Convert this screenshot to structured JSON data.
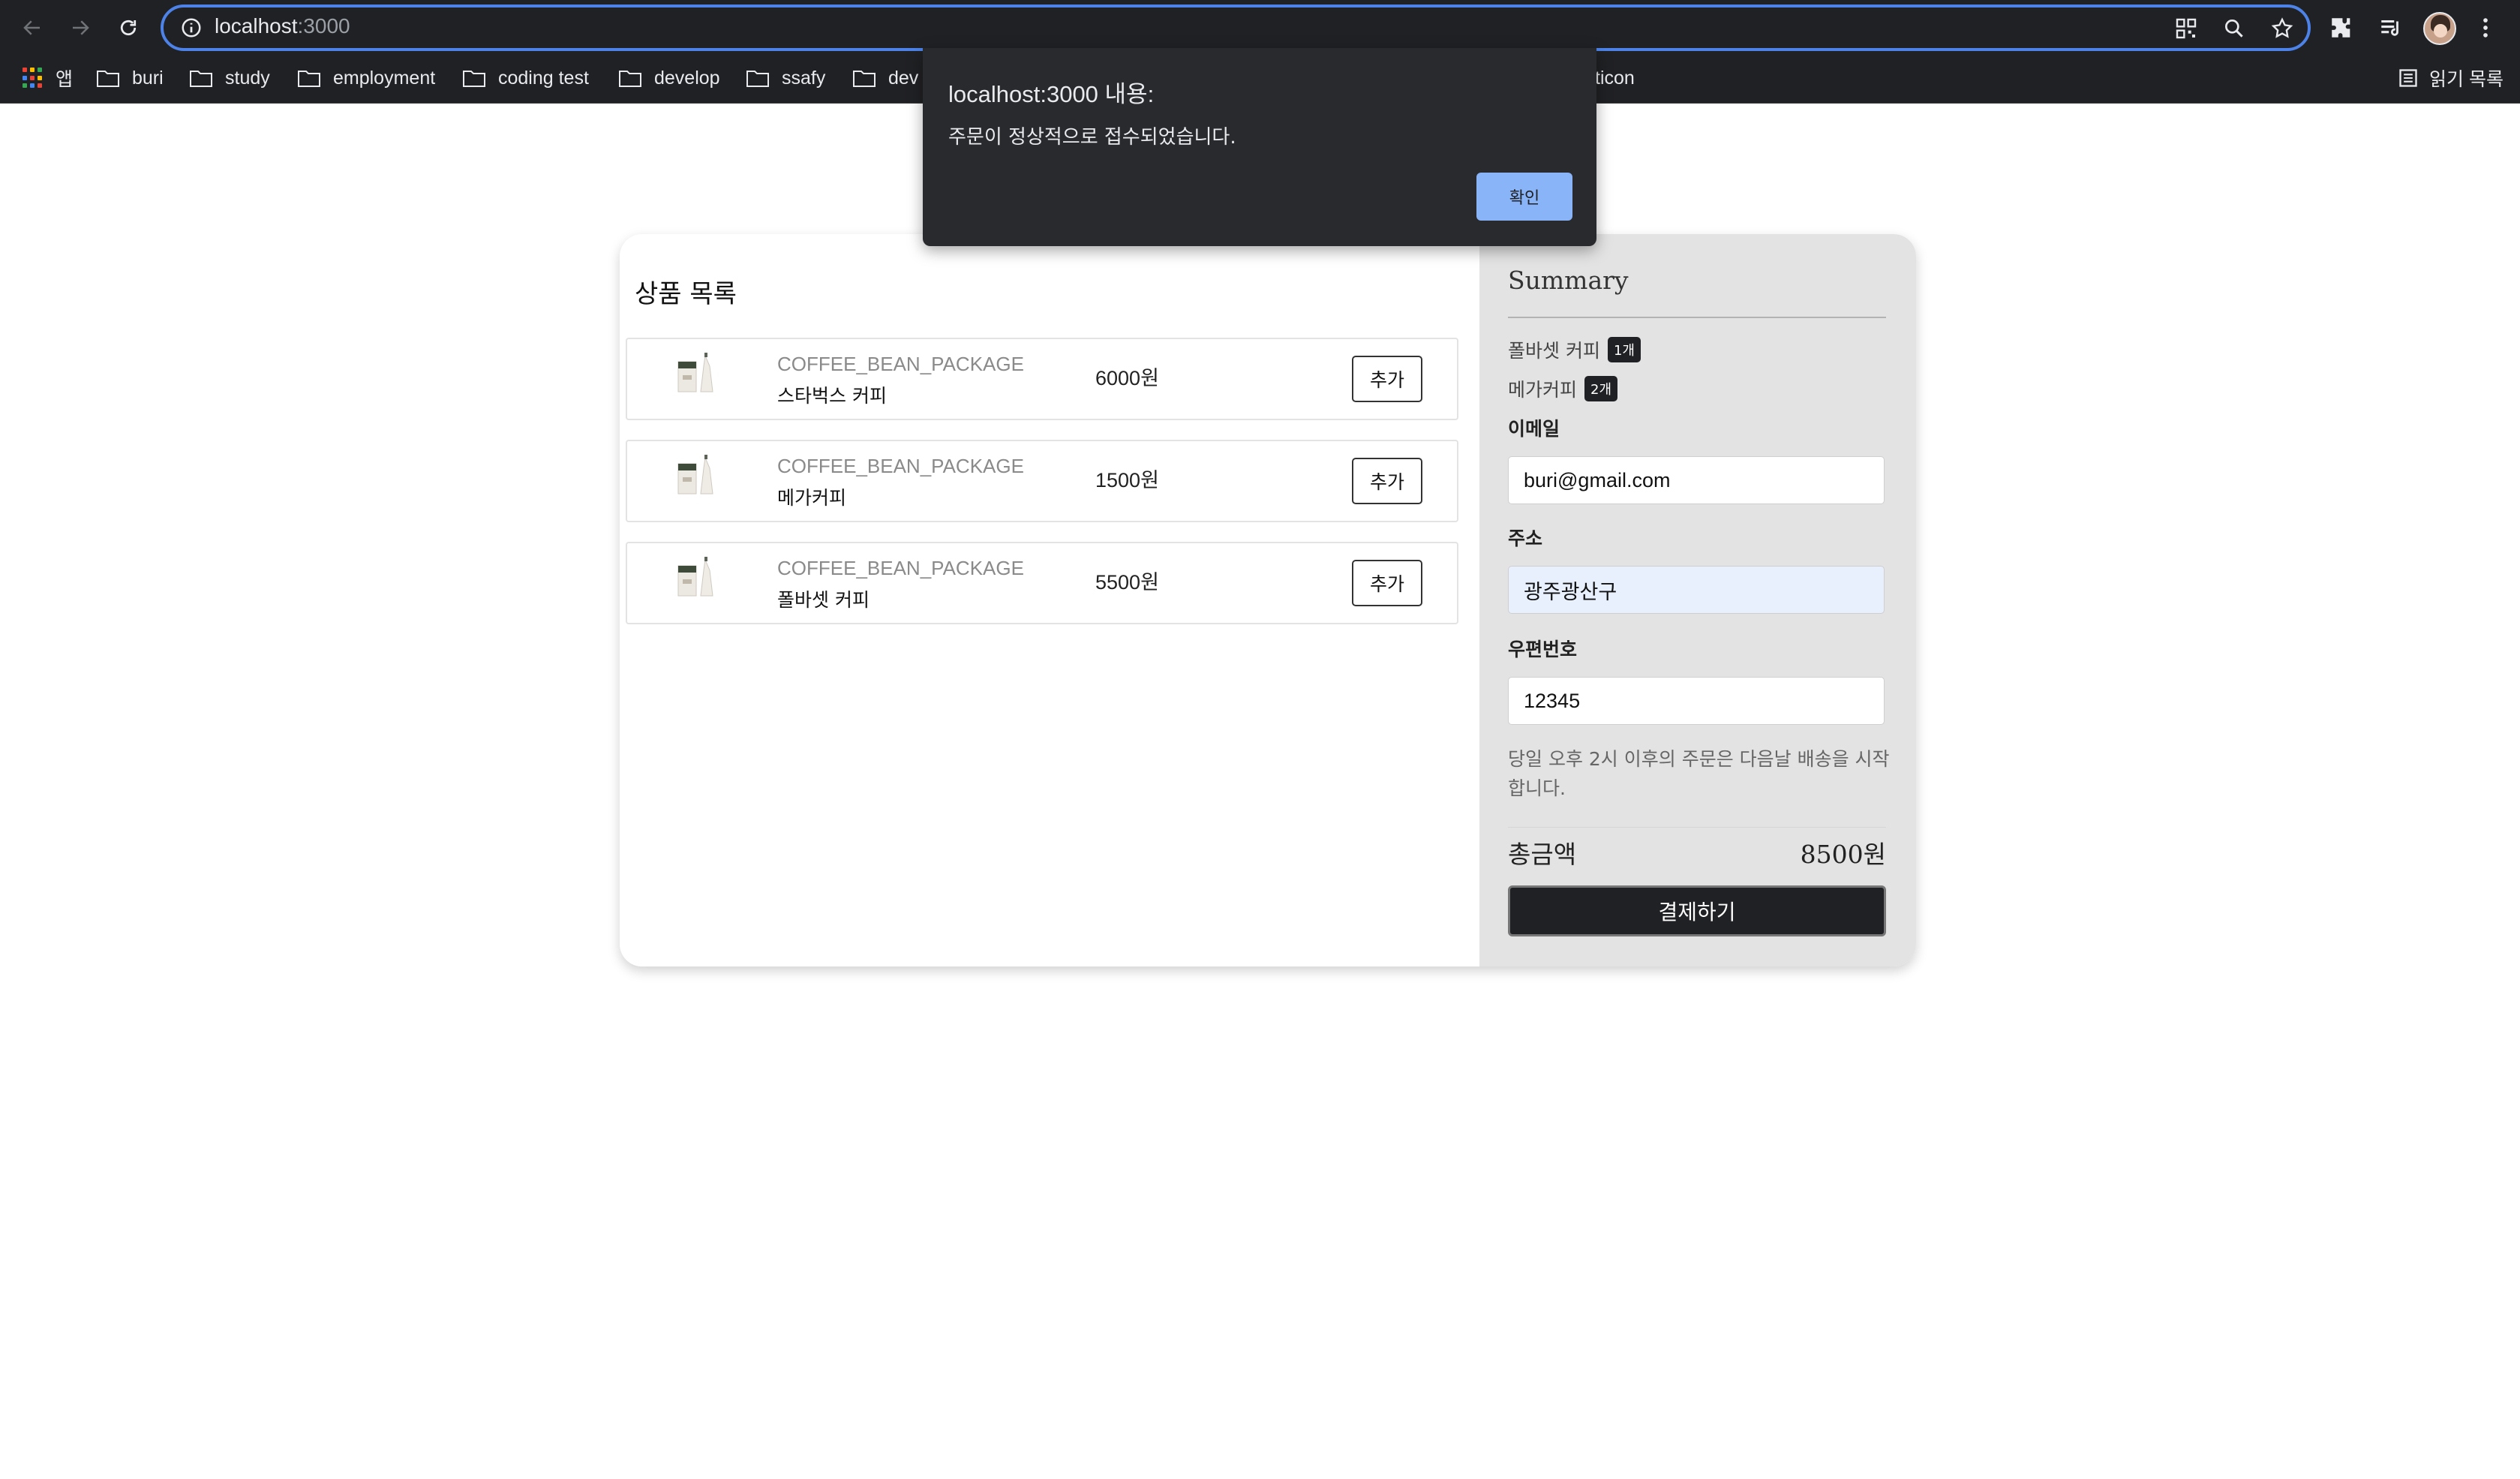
{
  "browser": {
    "url_host": "localhost",
    "url_port": ":3000",
    "bookmarks": [
      {
        "label": "앱",
        "icon": "apps-grid-icon"
      },
      {
        "label": "buri",
        "icon": "folder-icon"
      },
      {
        "label": "study",
        "icon": "folder-icon"
      },
      {
        "label": "employment",
        "icon": "folder-icon"
      },
      {
        "label": "coding test",
        "icon": "folder-icon"
      },
      {
        "label": "develop",
        "icon": "folder-icon"
      },
      {
        "label": "ssafy",
        "icon": "folder-icon"
      },
      {
        "label": "dev",
        "icon": "folder-icon"
      },
      {
        "label": "ticon",
        "icon": "folder-icon"
      }
    ],
    "reading_list": "읽기 목록",
    "accent_color": "#4d83e8"
  },
  "products": {
    "title": "상품 목록",
    "items": [
      {
        "category": "COFFEE_BEAN_PACKAGE",
        "name": "스타벅스 커피",
        "price": "6000원",
        "add_label": "추가"
      },
      {
        "category": "COFFEE_BEAN_PACKAGE",
        "name": "메가커피",
        "price": "1500원",
        "add_label": "추가"
      },
      {
        "category": "COFFEE_BEAN_PACKAGE",
        "name": "폴바셋 커피",
        "price": "5500원",
        "add_label": "추가"
      }
    ]
  },
  "summary": {
    "title": "Summary",
    "items": [
      {
        "name": "폴바셋 커피",
        "qty": "1개"
      },
      {
        "name": "메가커피",
        "qty": "2개"
      }
    ],
    "email_label": "이메일",
    "email_value": "buri@gmail.com",
    "address_label": "주소",
    "address_value": "광주광산구",
    "postcode_label": "우편번호",
    "postcode_value": "12345",
    "notice": "당일 오후 2시 이후의 주문은 다음날 배송을 시작합니다.",
    "total_label": "총금액",
    "total_value": "8500원",
    "pay_label": "결제하기"
  },
  "dialog": {
    "title": "localhost:3000 내용:",
    "message": "주문이 정상적으로 접수되었습니다.",
    "ok_label": "확인"
  }
}
